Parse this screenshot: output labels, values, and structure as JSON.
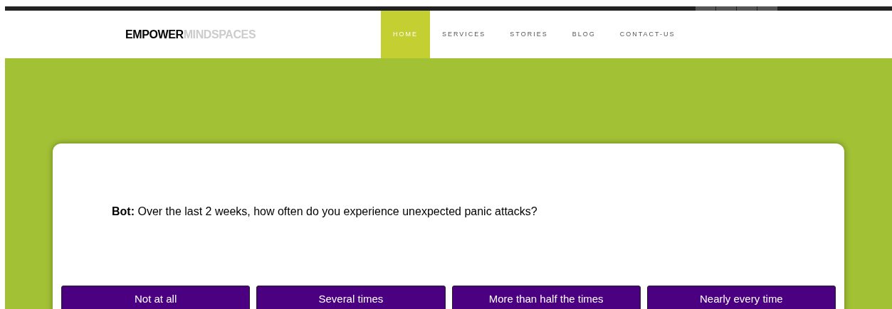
{
  "logo": {
    "bold": "EMPOWER",
    "light": "MINDSPACES"
  },
  "nav": [
    {
      "label": "HOME",
      "selected": true
    },
    {
      "label": "SERVICES",
      "selected": false
    },
    {
      "label": "STORIES",
      "selected": false
    },
    {
      "label": "BLOG",
      "selected": false
    },
    {
      "label": "CONTACT-US",
      "selected": false
    }
  ],
  "chat": {
    "speaker": "Bot:",
    "message": "Over the last 2 weeks, how often do you experience unexpected panic attacks?"
  },
  "answers": [
    "Not at all",
    "Several times",
    "More than half the times",
    "Nearly every time"
  ]
}
